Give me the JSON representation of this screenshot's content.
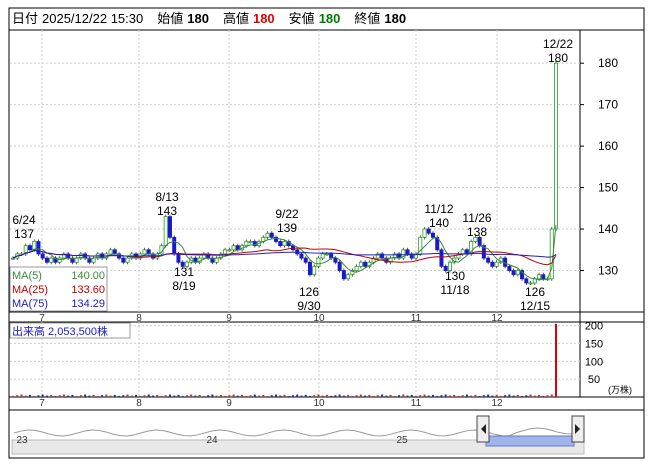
{
  "header": {
    "date_label": "日付",
    "date": "2025/12/22 15:30",
    "open_label": "始値",
    "open": "180",
    "high_label": "高値",
    "high": "180",
    "low_label": "安値",
    "low": "180",
    "close_label": "終値",
    "close": "180"
  },
  "colors": {
    "up": "#2a9d2a",
    "down": "#1a1acc",
    "ma5": "#3a8a3a",
    "ma25": "#c00000",
    "ma75": "#2020c0",
    "volume": "#e00000",
    "grid": "#cccccc",
    "frame": "#000000"
  },
  "chart_data": [
    {
      "type": "candlestick",
      "title": "",
      "y_ticks": [
        130,
        140,
        150,
        160,
        170,
        180
      ],
      "ylim": [
        120,
        188
      ],
      "month_labels": [
        "7",
        "8",
        "9",
        "10",
        "11",
        "12"
      ],
      "legend": [
        {
          "name": "MA(5)",
          "value": "140.00"
        },
        {
          "name": "MA(25)",
          "value": "133.60"
        },
        {
          "name": "MA(75)",
          "value": "134.29"
        }
      ],
      "close_series": [
        133,
        134,
        134,
        136,
        135,
        137,
        134,
        133,
        132,
        133,
        132,
        133,
        134,
        133,
        132,
        133,
        134,
        133,
        132,
        133,
        134,
        133,
        134,
        135,
        134,
        133,
        132,
        133,
        134,
        133,
        134,
        135,
        134,
        133,
        134,
        136,
        143,
        138,
        134,
        132,
        131,
        132,
        133,
        132,
        133,
        134,
        133,
        132,
        133,
        134,
        135,
        135,
        136,
        135,
        136,
        137,
        137,
        136,
        137,
        138,
        139,
        138,
        137,
        136,
        137,
        136,
        135,
        134,
        133,
        132,
        129,
        131,
        133,
        134,
        134,
        133,
        132,
        130,
        128,
        129,
        130,
        131,
        132,
        131,
        132,
        133,
        134,
        133,
        132,
        133,
        134,
        133,
        135,
        134,
        133,
        134,
        138,
        140,
        139,
        138,
        135,
        131,
        130,
        132,
        133,
        134,
        135,
        134,
        137,
        138,
        136,
        133,
        132,
        131,
        132,
        133,
        131,
        130,
        129,
        130,
        128,
        127,
        127,
        128,
        129,
        128,
        128,
        140,
        180
      ],
      "annotations": [
        {
          "date": "6/24",
          "price": "137",
          "kind": "high"
        },
        {
          "date": "8/13",
          "price": "143",
          "kind": "high"
        },
        {
          "date": "8/19",
          "price": "131",
          "kind": "low"
        },
        {
          "date": "9/22",
          "price": "139",
          "kind": "high"
        },
        {
          "date": "9/30",
          "price": "126",
          "kind": "low"
        },
        {
          "date": "11/12",
          "price": "140",
          "kind": "high"
        },
        {
          "date": "11/18",
          "price": "130",
          "kind": "low"
        },
        {
          "date": "11/26",
          "price": "138",
          "kind": "high"
        },
        {
          "date": "12/15",
          "price": "126",
          "kind": "low"
        },
        {
          "date": "12/22",
          "price": "180",
          "kind": "high"
        }
      ]
    },
    {
      "type": "bar",
      "title": "出来高",
      "total_label": "2,053,500株",
      "unit": "(万株)",
      "y_ticks": [
        50,
        100,
        150,
        200
      ],
      "ylim": [
        0,
        210
      ],
      "last_value": 205
    }
  ],
  "navigator": {
    "labels": [
      "23",
      "24",
      "25"
    ]
  }
}
